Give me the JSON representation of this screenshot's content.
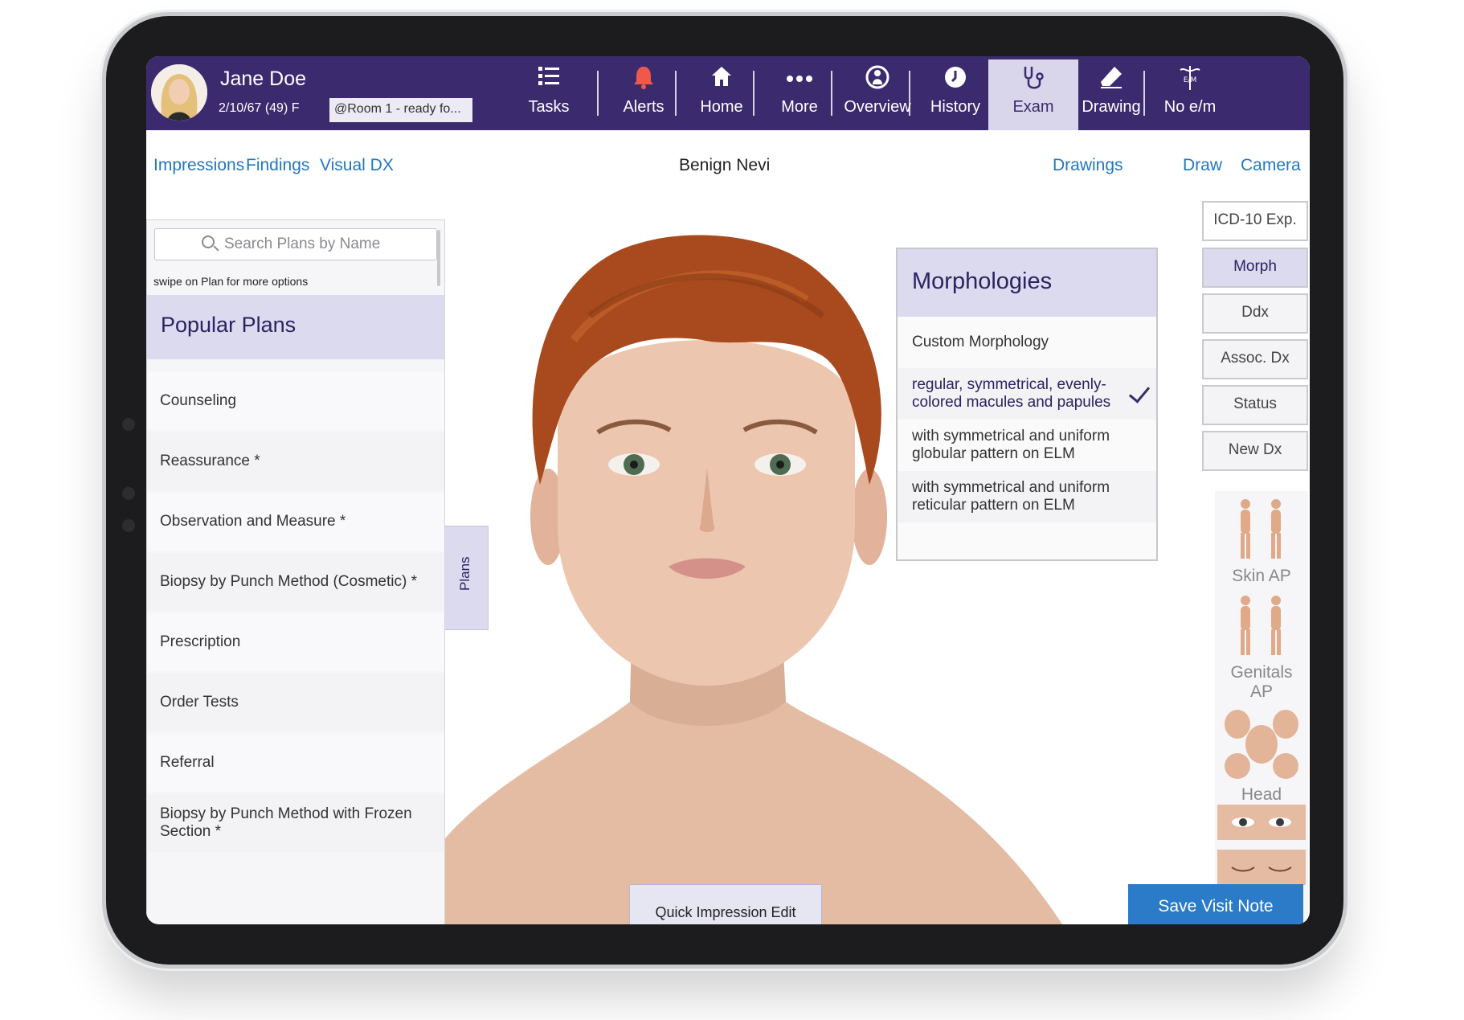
{
  "patient": {
    "name": "Jane Doe",
    "dob_age_sex": "2/10/67 (49) F",
    "room_status": "@Room 1 - ready fo..."
  },
  "nav": {
    "tasks": "Tasks",
    "alerts": "Alerts",
    "home": "Home",
    "more": "More",
    "overview": "Overview",
    "history": "History",
    "exam": "Exam",
    "drawing": "Drawing",
    "no_em": "No e/m",
    "no_em_icon_text": "E/M",
    "active": "Exam"
  },
  "subnav": {
    "impressions": "Impressions",
    "findings": "Findings",
    "visual_dx": "Visual DX",
    "title": "Benign Nevi",
    "drawings": "Drawings",
    "draw": "Draw",
    "camera": "Camera"
  },
  "plans": {
    "search_placeholder": "Search Plans by Name",
    "swipe_hint": "swipe on Plan for more options",
    "section_title": "Popular Plans",
    "items": [
      "Counseling",
      "Reassurance *",
      "Observation and Measure *",
      "Biopsy by Punch Method (Cosmetic) *",
      "Prescription",
      "Order Tests",
      "Referral",
      "Biopsy by Punch Method with Frozen Section *"
    ],
    "tab_label": "Plans"
  },
  "morphologies": {
    "title": "Morphologies",
    "items": [
      "Custom Morphology",
      "regular, symmetrical, evenly-colored macules and papules",
      "with symmetrical and uniform globular pattern on ELM",
      "with symmetrical and uniform reticular pattern on ELM"
    ],
    "selected_index": 1
  },
  "side_tabs": {
    "icd": "ICD-10 Exp.",
    "morph": "Morph",
    "ddx": "Ddx",
    "assoc_dx": "Assoc. Dx",
    "status": "Status",
    "new_dx": "New Dx",
    "active": "Morph"
  },
  "body_maps": {
    "skin_ap": "Skin AP",
    "genitals_ap": "Genitals AP",
    "head": "Head"
  },
  "actions": {
    "quick_impression_edit": "Quick Impression Edit",
    "save_visit_note": "Save Visit Note"
  },
  "colors": {
    "header_bg": "#3b2b6e",
    "accent_lavender": "#dcdaef",
    "link_blue": "#2377c0",
    "save_button": "#2c7bc8"
  }
}
